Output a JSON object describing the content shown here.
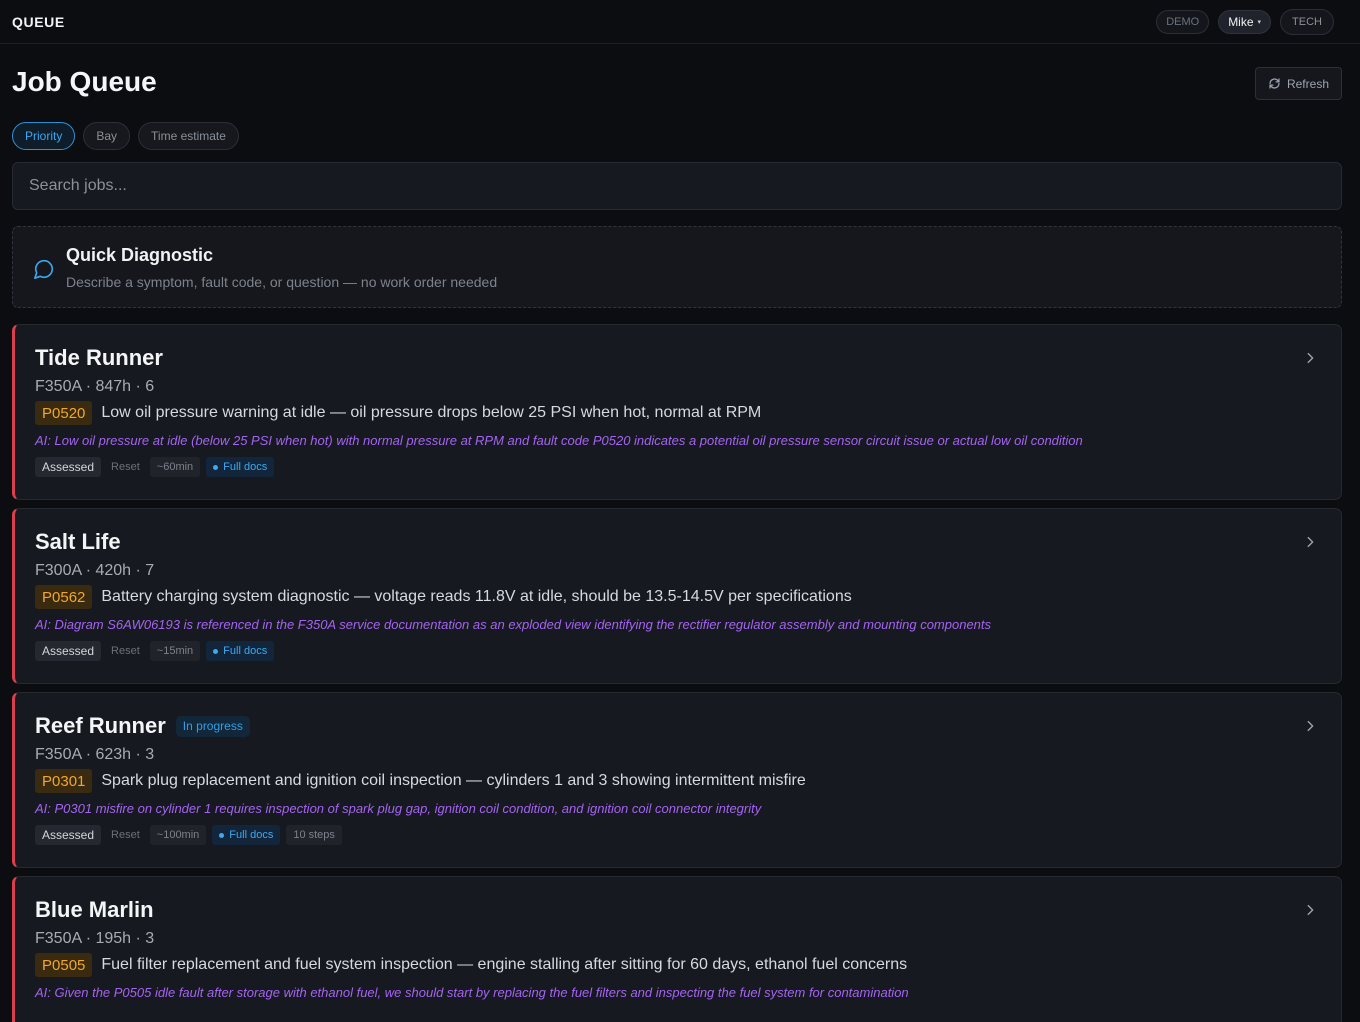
{
  "topbar": {
    "brand": "QUEUE",
    "demo": "DEMO",
    "user": "Mike",
    "user_caret": "▾",
    "role": "TECH"
  },
  "page": {
    "title": "Job Queue",
    "refresh_label": "Refresh"
  },
  "filters": [
    {
      "label": "Priority",
      "active": true
    },
    {
      "label": "Bay",
      "active": false
    },
    {
      "label": "Time estimate",
      "active": false
    }
  ],
  "search": {
    "placeholder": "Search jobs...",
    "value": ""
  },
  "quick_diagnostic": {
    "title": "Quick Diagnostic",
    "subtitle": "Describe a symptom, fault code, or question — no work order needed"
  },
  "jobs": [
    {
      "name": "Tide Runner",
      "status": "",
      "meta": "F350A · 847h · 6",
      "code": "P0520",
      "issue": "Low oil pressure warning at idle — oil pressure drops below 25 PSI when hot, normal at RPM",
      "ai": "AI: Low oil pressure at idle (below 25 PSI when hot) with normal pressure at RPM and fault code P0520 indicates a potential oil pressure sensor circuit issue or actual low oil condition",
      "assessed": "Assessed",
      "reset": "Reset",
      "time": "~60min",
      "docs": "Full docs",
      "steps": ""
    },
    {
      "name": "Salt Life",
      "status": "",
      "meta": "F300A · 420h · 7",
      "code": "P0562",
      "issue": "Battery charging system diagnostic — voltage reads 11.8V at idle, should be 13.5-14.5V per specifications",
      "ai": "AI: Diagram S6AW06193 is referenced in the F350A service documentation as an exploded view identifying the rectifier regulator assembly and mounting components",
      "assessed": "Assessed",
      "reset": "Reset",
      "time": "~15min",
      "docs": "Full docs",
      "steps": ""
    },
    {
      "name": "Reef Runner",
      "status": "In progress",
      "meta": "F350A · 623h · 3",
      "code": "P0301",
      "issue": "Spark plug replacement and ignition coil inspection — cylinders 1 and 3 showing intermittent misfire",
      "ai": "AI: P0301 misfire on cylinder 1 requires inspection of spark plug gap, ignition coil condition, and ignition coil connector integrity",
      "assessed": "Assessed",
      "reset": "Reset",
      "time": "~100min",
      "docs": "Full docs",
      "steps": "10 steps"
    },
    {
      "name": "Blue Marlin",
      "status": "",
      "meta": "F350A · 195h · 3",
      "code": "P0505",
      "issue": "Fuel filter replacement and fuel system inspection — engine stalling after sitting for 60 days, ethanol fuel concerns",
      "ai": "AI: Given the P0505 idle fault after storage with ethanol fuel, we should start by replacing the fuel filters and inspecting the fuel system for contamination",
      "assessed": "",
      "reset": "",
      "time": "",
      "docs": "",
      "steps": ""
    }
  ],
  "colors": {
    "background": "#0c0d11",
    "card": "#171920",
    "priority_border": "#d9404d",
    "accent_blue": "#3aa7f0",
    "code_amber": "#f0a72f",
    "ai_purple": "#a463f2"
  }
}
